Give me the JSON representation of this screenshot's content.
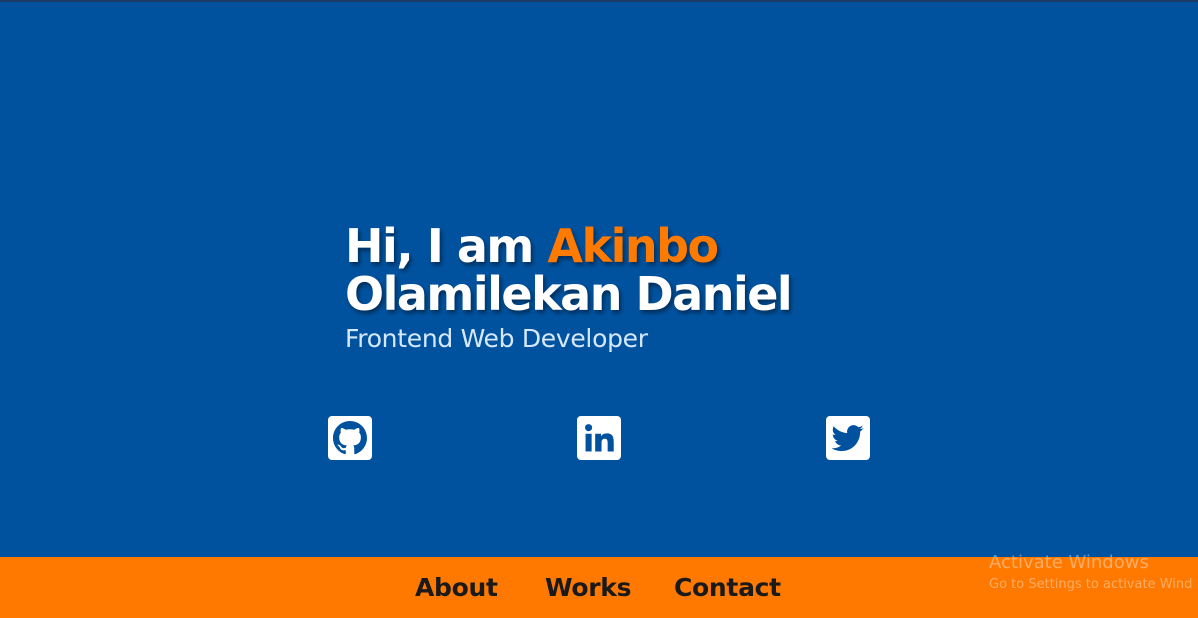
{
  "hero": {
    "greeting": "Hi, I am",
    "name_highlight": "Akinbo",
    "name_rest": "Olamilekan Daniel",
    "role": "Frontend Web Developer"
  },
  "social": [
    {
      "icon": "github-icon"
    },
    {
      "icon": "linkedin-icon"
    },
    {
      "icon": "twitter-icon"
    }
  ],
  "nav": {
    "about": "About",
    "works": "Works",
    "contact": "Contact"
  },
  "os_watermark": {
    "title": "Activate Windows",
    "subtitle": "Go to Settings to activate Wind"
  },
  "colors": {
    "background": "#00529f",
    "accent": "#ff7a00",
    "navbar": "#ff7900",
    "text": "#ffffff"
  }
}
